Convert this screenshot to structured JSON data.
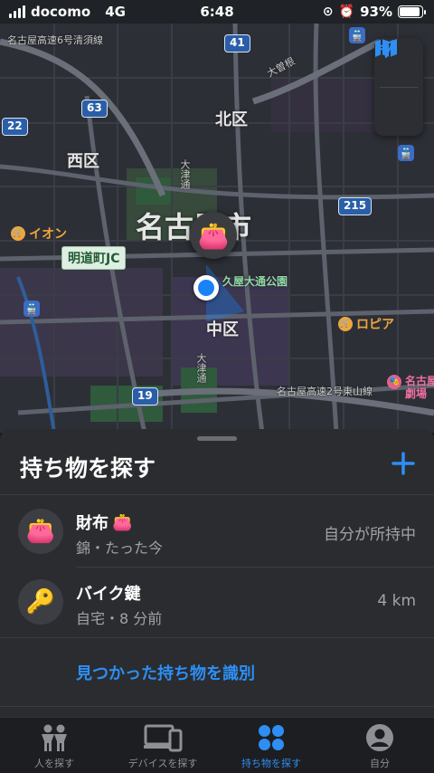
{
  "status": {
    "carrier": "docomo",
    "network": "4G",
    "time": "6:48",
    "battery": "93%",
    "battery_level": 0.93
  },
  "map": {
    "labels": {
      "highway_top": "名古屋高速6号清須線",
      "kita_ku": "北区",
      "nishi_ku": "西区",
      "ozone": "大曽根",
      "nagoya_city": "名古屋市",
      "naka_ku": "中区",
      "hisaya": "久屋大通公園",
      "otsu1": "大津通",
      "otsu2": "大津通",
      "highway_bottom": "名古屋高速2号東山線",
      "meidocho_jc": "明道町JC",
      "aeon": "イオン",
      "lopia": "ロピア",
      "theater": "名古屋\n劇場"
    },
    "shields": [
      "41",
      "63",
      "22",
      "215",
      "19"
    ],
    "pin_emoji": "👛"
  },
  "sheet": {
    "title": "持ち物を探す",
    "items": [
      {
        "icon": "👛",
        "name": "財布",
        "name_emoji": "👛",
        "sub": "錦・たった今",
        "right": "自分が所持中"
      },
      {
        "icon": "🔑",
        "name": "バイク鍵",
        "sub": "自宅・8 分前",
        "right": "4 km"
      }
    ],
    "identify_label": "見つかった持ち物を識別"
  },
  "tabs": [
    {
      "label": "人を探す",
      "icon": "people-icon",
      "active": false
    },
    {
      "label": "デバイスを探す",
      "icon": "devices-icon",
      "active": false
    },
    {
      "label": "持ち物を探す",
      "icon": "items-icon",
      "active": true
    },
    {
      "label": "自分",
      "icon": "person-icon",
      "active": false
    }
  ],
  "colors": {
    "accent": "#2e8ef3",
    "location_blue": "#1a82f7"
  }
}
